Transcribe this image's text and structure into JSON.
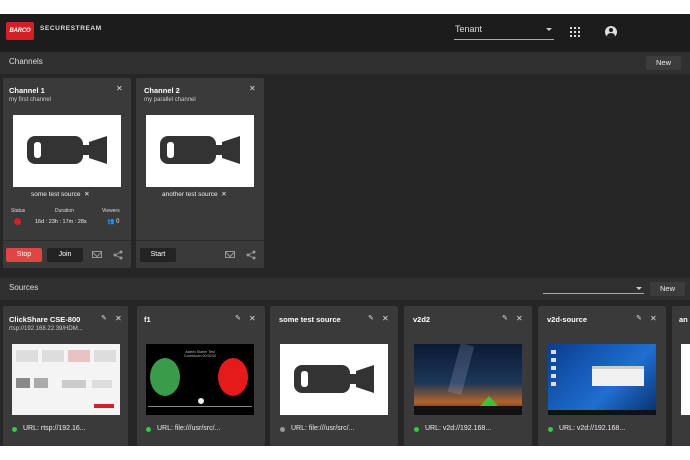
{
  "header": {
    "logo_text": "BARCO",
    "app_name": "SECURESTREAM",
    "tenant_label": "Tenant",
    "icons": [
      "apps-grid-icon",
      "account-circle-icon"
    ]
  },
  "channels_section": {
    "title": "Channels",
    "new_label": "New",
    "cards": [
      {
        "title": "Channel 1",
        "subtitle": "my first channel",
        "source_tag": "some test source",
        "status_label": "Status",
        "duration_label": "Duration",
        "viewers_label": "Viewers",
        "duration_value": "16d : 23h : 17m : 28s",
        "viewers_value": "0",
        "buttons": [
          "Stop",
          "Join"
        ]
      },
      {
        "title": "Channel 2",
        "subtitle": "my parallel channel",
        "source_tag": "another test source",
        "buttons": [
          "Start"
        ]
      }
    ]
  },
  "sources_section": {
    "title": "Sources",
    "new_label": "New",
    "cards": [
      {
        "title": "ClickShare CSE-800",
        "subtitle": "rtsp://192.168.22.39/HDM...",
        "url": "URL: rtsp://192.16...",
        "status": "online"
      },
      {
        "title": "f1",
        "url": "URL: file:///usr/src/...",
        "status": "online",
        "thumb_text": "Asterix Starter Test\nCountdown 00:00:00"
      },
      {
        "title": "some test source",
        "url": "URL: file:///usr/src/...",
        "status": "offline"
      },
      {
        "title": "v2d2",
        "url": "URL: v2d://192.168...",
        "status": "online"
      },
      {
        "title": "v2d-source",
        "url": "URL: v2d://192.168...",
        "status": "online"
      },
      {
        "title": "an"
      }
    ]
  },
  "colors": {
    "accent_red": "#d32027",
    "stop_red": "#e04545",
    "online_green": "#2ecc40"
  }
}
